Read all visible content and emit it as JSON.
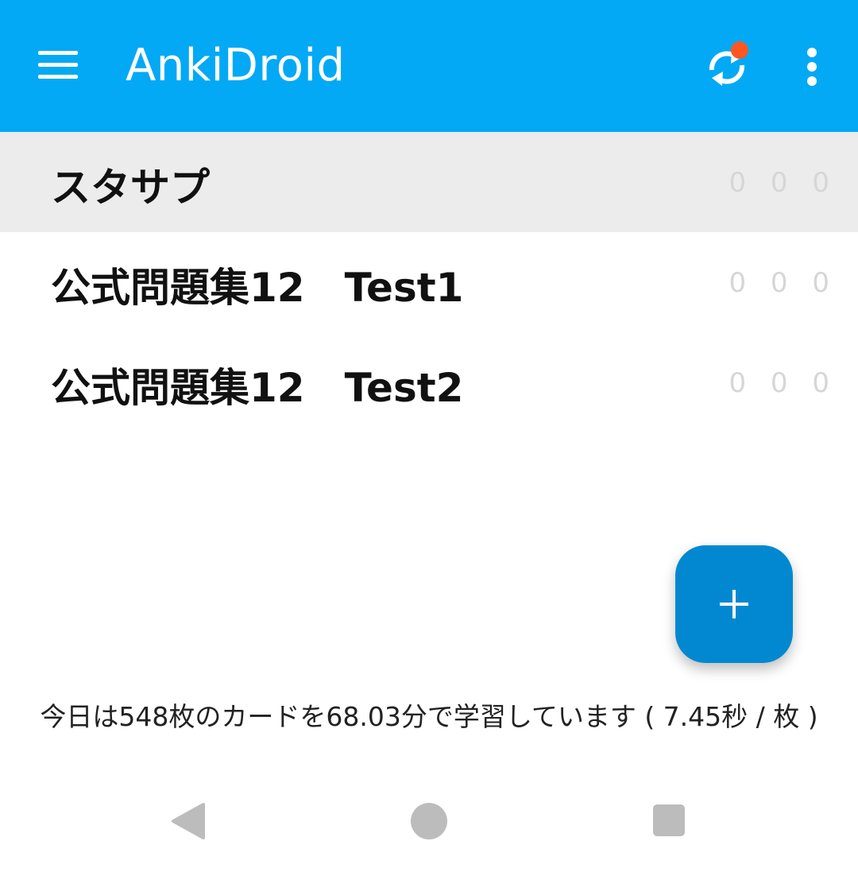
{
  "app": {
    "title": "AnkiDroid"
  },
  "toolbar": {
    "menu_icon": "hamburger-menu-icon",
    "sync_icon": "sync-icon",
    "sync_badge_color": "#ff5722",
    "more_icon": "overflow-menu-icon",
    "background": "#03a9f4"
  },
  "decks": [
    {
      "name": "スタサプ",
      "counts": "0 0 0",
      "selected": true
    },
    {
      "name": "公式問題集12　Test1",
      "counts": "0 0 0",
      "selected": false
    },
    {
      "name": "公式問題集12　Test2",
      "counts": "0 0 0",
      "selected": false
    }
  ],
  "fab": {
    "icon": "plus-icon",
    "color": "#0288d1"
  },
  "stats": {
    "text": "今日は548枚のカードを68.03分で学習しています ( 7.45秒 / 枚 )"
  },
  "navbar": {
    "back_icon": "back-triangle-icon",
    "home_icon": "home-circle-icon",
    "recent_icon": "recent-apps-square-icon"
  }
}
